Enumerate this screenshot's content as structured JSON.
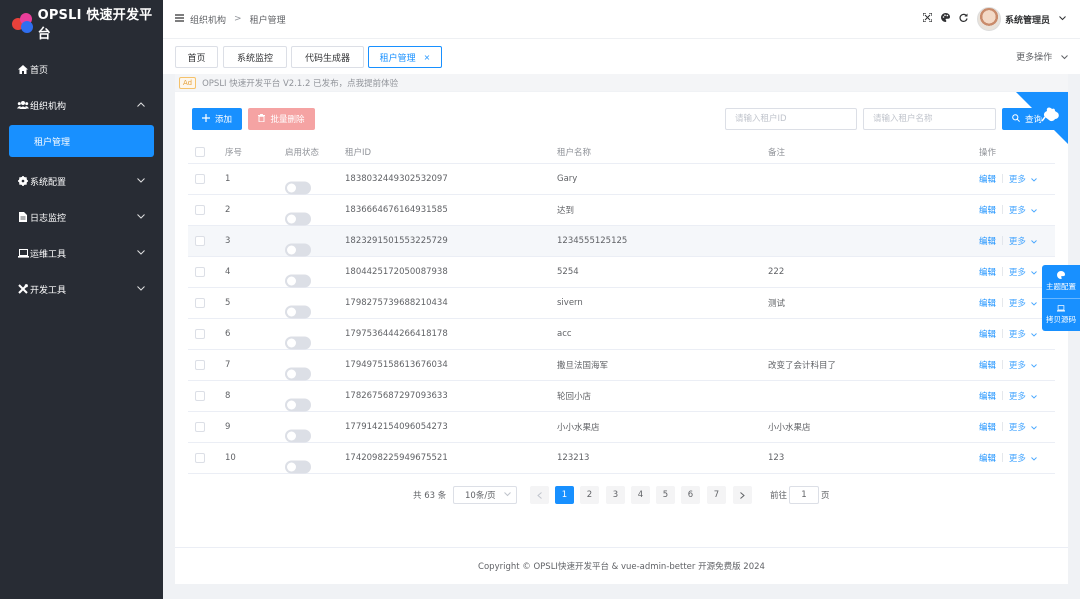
{
  "app": {
    "title": "OPSLI 快速开发平台"
  },
  "sidebar": {
    "items": [
      {
        "label": "首页",
        "icon": "home-icon"
      },
      {
        "label": "组织机构",
        "icon": "users-icon",
        "expanded": true,
        "children": [
          {
            "label": "租户管理",
            "active": true
          }
        ]
      },
      {
        "label": "系统配置",
        "icon": "gear-icon"
      },
      {
        "label": "日志监控",
        "icon": "file-icon"
      },
      {
        "label": "运维工具",
        "icon": "laptop-icon"
      },
      {
        "label": "开发工具",
        "icon": "tools-icon"
      }
    ]
  },
  "header": {
    "breadcrumb": [
      "组织机构",
      "租户管理"
    ],
    "user_name": "系统管理员"
  },
  "tabs": [
    {
      "label": "首页"
    },
    {
      "label": "系统监控"
    },
    {
      "label": "代码生成器"
    },
    {
      "label": "租户管理",
      "active": true,
      "close": "×"
    }
  ],
  "more_ops": "更多操作",
  "ad": {
    "tag": "Ad",
    "text": "OPSLI 快速开发平台 V2.1.2 已发布，点我提前体验"
  },
  "toolbar": {
    "add_label": "添加",
    "batch_delete_label": "批量删除",
    "search_id_placeholder": "请输入租户ID",
    "search_name_placeholder": "请输入租户名称",
    "query_label": "查询"
  },
  "table": {
    "columns": [
      "序号",
      "启用状态",
      "租户ID",
      "租户名称",
      "备注",
      "操作"
    ],
    "rows": [
      {
        "index": "1",
        "enabled": false,
        "id": "1838032449302532097",
        "name": "Gary",
        "remark": ""
      },
      {
        "index": "2",
        "enabled": false,
        "id": "1836664676164931585",
        "name": "达到",
        "remark": ""
      },
      {
        "index": "3",
        "enabled": false,
        "id": "1823291501553225729",
        "name": "1234555125125",
        "remark": ""
      },
      {
        "index": "4",
        "enabled": false,
        "id": "1804425172050087938",
        "name": "5254",
        "remark": "222"
      },
      {
        "index": "5",
        "enabled": false,
        "id": "1798275739688210434",
        "name": "sivern",
        "remark": "测试"
      },
      {
        "index": "6",
        "enabled": false,
        "id": "1797536444266418178",
        "name": "acc",
        "remark": ""
      },
      {
        "index": "7",
        "enabled": false,
        "id": "1794975158613676034",
        "name": "撒旦法国海军",
        "remark": "改变了会计科目了"
      },
      {
        "index": "8",
        "enabled": false,
        "id": "1782675687297093633",
        "name": "轮回小店",
        "remark": ""
      },
      {
        "index": "9",
        "enabled": false,
        "id": "1779142154096054273",
        "name": "小小水果店",
        "remark": "小小水果店"
      },
      {
        "index": "10",
        "enabled": false,
        "id": "1742098225949675521",
        "name": "123213",
        "remark": "123"
      }
    ],
    "op_edit": "编辑",
    "op_more": "更多"
  },
  "pagination": {
    "total_text": "共 63 条",
    "page_size": "10条/页",
    "pages": [
      "1",
      "2",
      "3",
      "4",
      "5",
      "6",
      "7"
    ],
    "current": "1",
    "goto_prefix": "前往",
    "goto_value": "1",
    "goto_suffix": "页"
  },
  "footer": {
    "copyright": "Copyright © OPSLI快速开发平台 & vue-admin-better 开源免费版 2024"
  },
  "float_panel": {
    "theme_label": "主题配置",
    "copy_label": "拷贝源码"
  },
  "colors": {
    "primary": "#1890ff",
    "sidebar_bg": "#282c34",
    "danger_light": "#f5a3a3"
  }
}
